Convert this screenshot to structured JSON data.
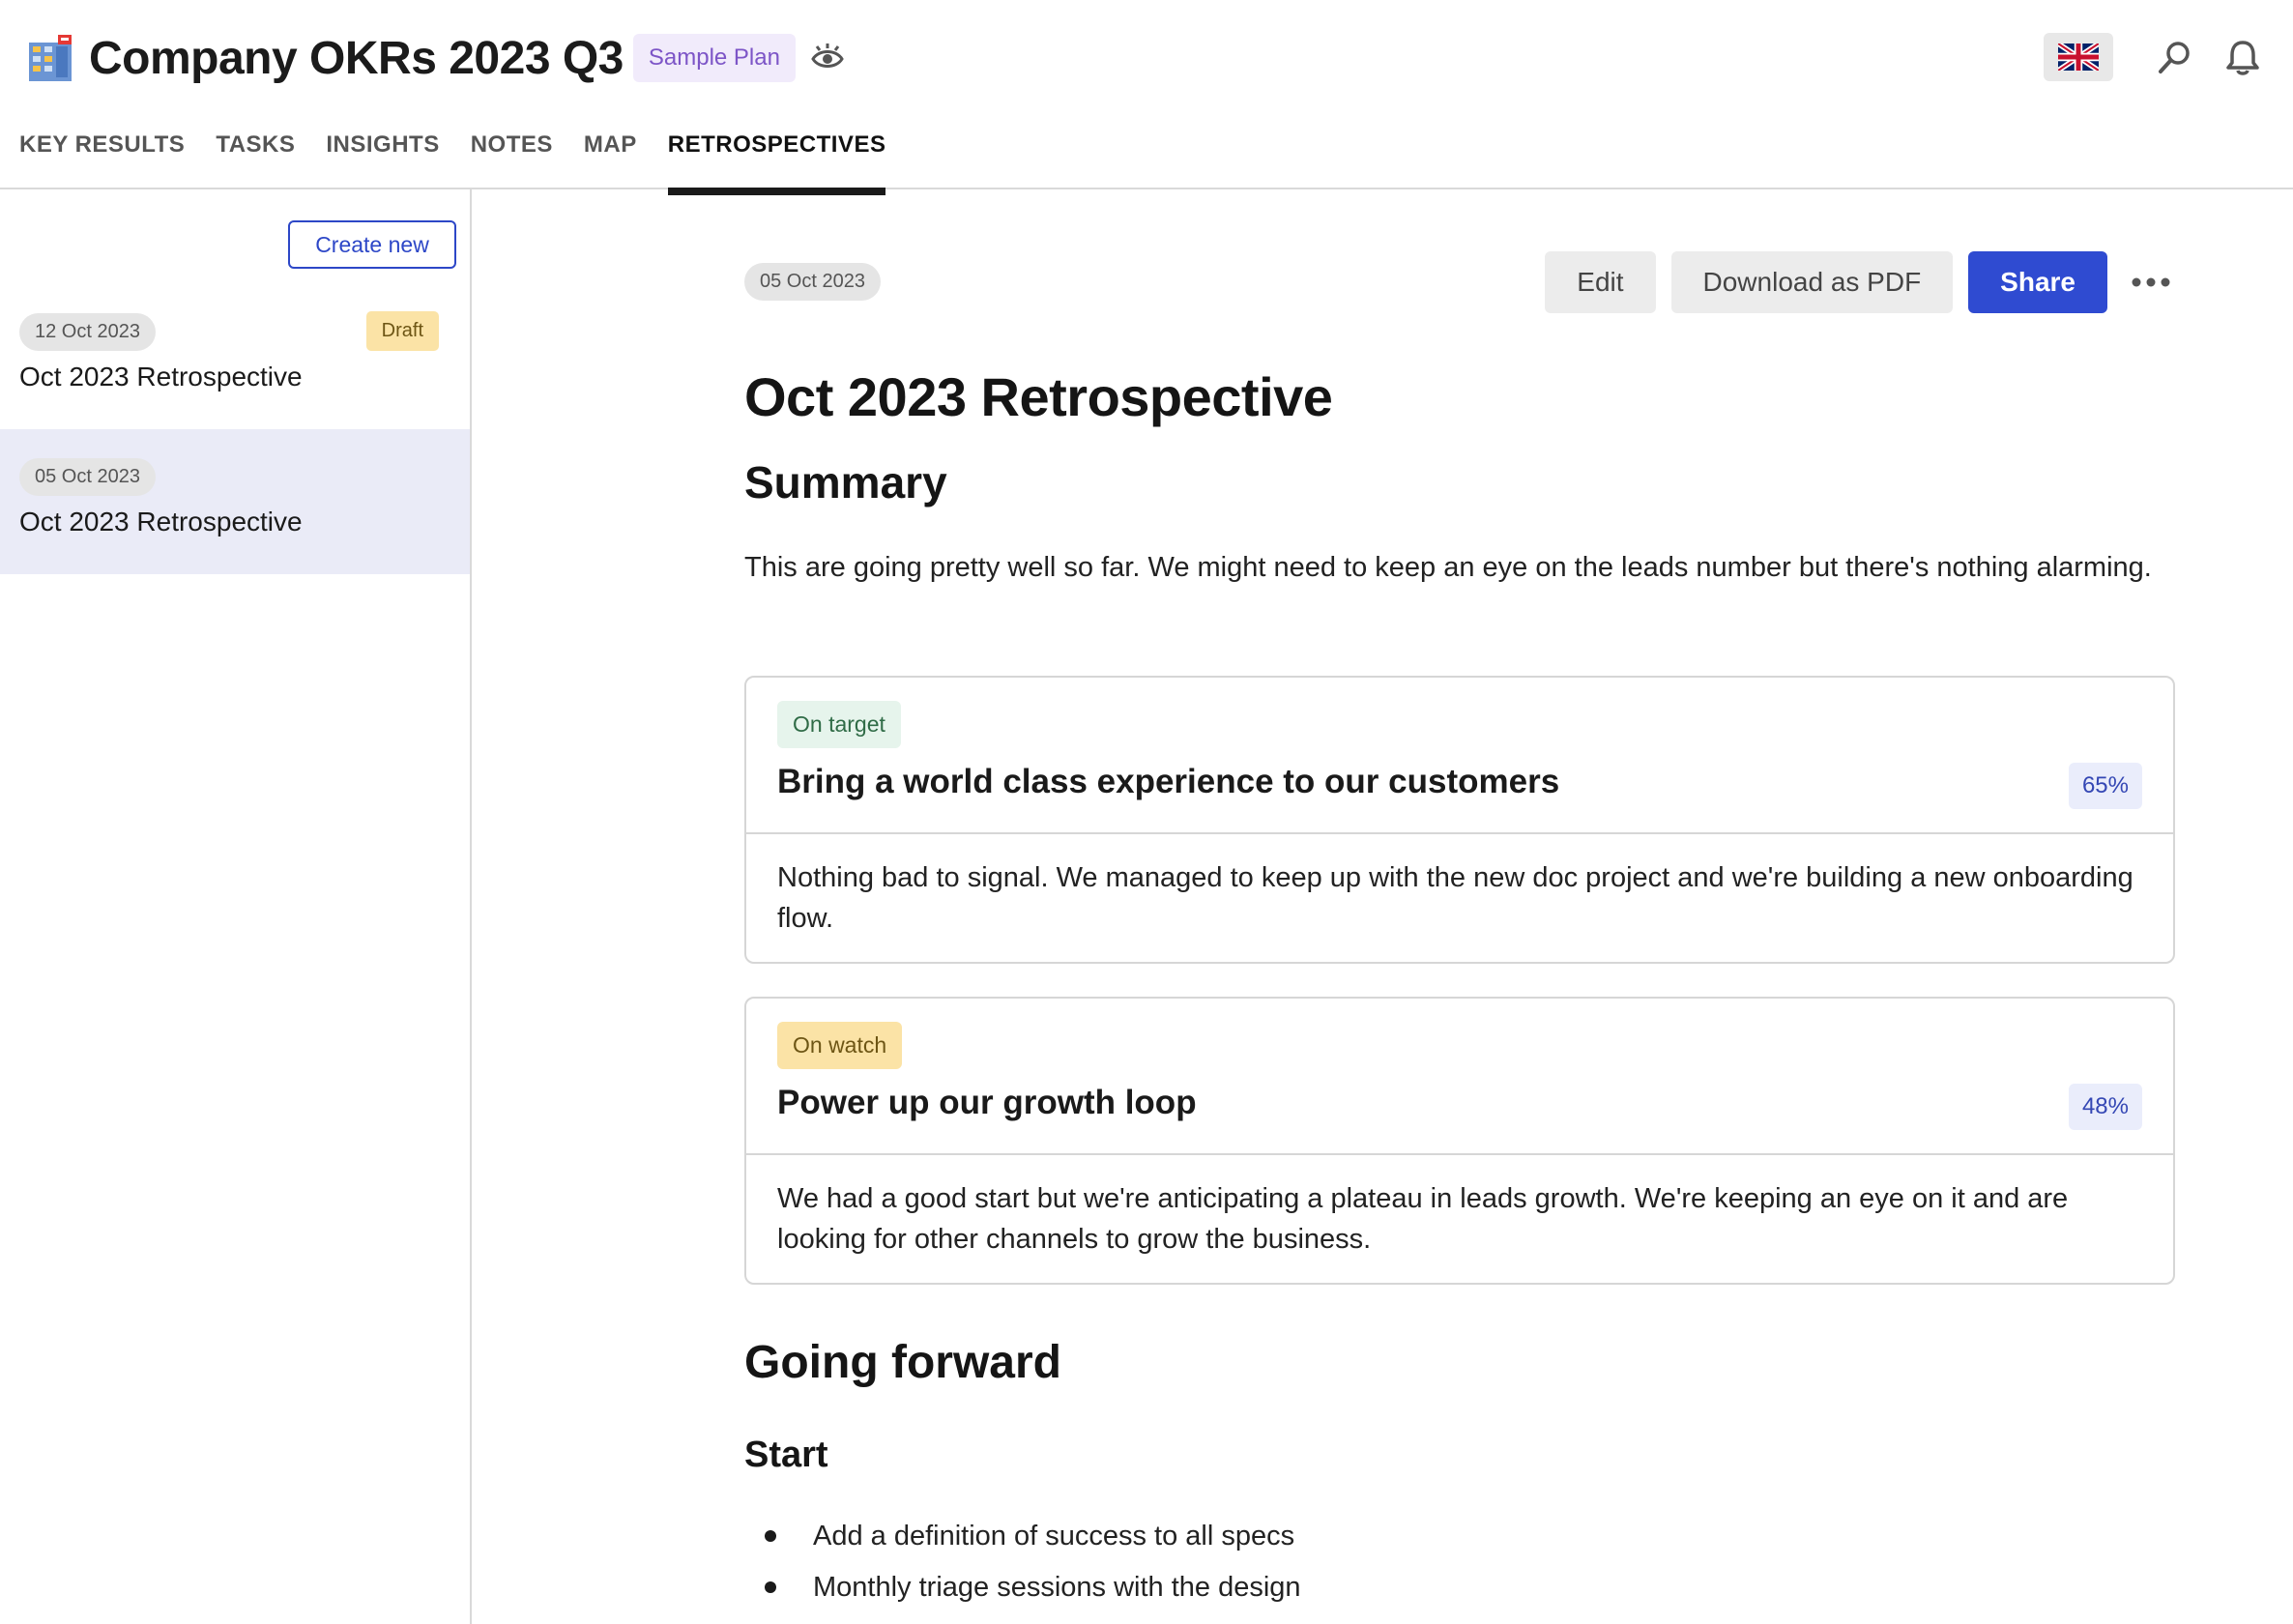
{
  "header": {
    "title": "Company OKRs 2023 Q3",
    "plan_badge": "Sample Plan",
    "app_icon": "building-icon",
    "language_flag": "uk-flag-icon"
  },
  "tabs": [
    {
      "label": "KEY RESULTS",
      "active": false
    },
    {
      "label": "TASKS",
      "active": false
    },
    {
      "label": "INSIGHTS",
      "active": false
    },
    {
      "label": "NOTES",
      "active": false
    },
    {
      "label": "MAP",
      "active": false
    },
    {
      "label": "RETROSPECTIVES",
      "active": true
    }
  ],
  "sidebar": {
    "create_label": "Create new",
    "items": [
      {
        "date": "12 Oct 2023",
        "title": "Oct 2023 Retrospective",
        "badge": "Draft",
        "selected": false
      },
      {
        "date": "05 Oct 2023",
        "title": "Oct 2023 Retrospective",
        "badge": "",
        "selected": true
      }
    ]
  },
  "main": {
    "date": "05 Oct 2023",
    "actions": {
      "edit": "Edit",
      "download": "Download as PDF",
      "share": "Share"
    },
    "title": "Oct 2023 Retrospective",
    "summary_heading": "Summary",
    "summary_text": "This are going pretty well so far. We might need to keep an eye on the leads number but there's nothing alarming.",
    "objectives": [
      {
        "status": "On target",
        "title": "Bring a world class experience to our customers",
        "progress": "65%",
        "note": "Nothing bad to signal. We managed to keep up with the new doc project and we're building a new onboarding flow."
      },
      {
        "status": "On watch",
        "title": "Power up our growth loop",
        "progress": "48%",
        "note": "We had a good start but we're anticipating a plateau in leads growth. We're keeping an eye on it and are looking for other channels to grow the business."
      }
    ],
    "forward_heading": "Going forward",
    "start_heading": "Start",
    "start_items": [
      "Add a definition of success to all specs",
      "Monthly triage sessions with the design"
    ]
  },
  "colors": {
    "accent": "#2f4bd1",
    "on_target_bg": "#e6f4ec",
    "on_watch_bg": "#fbe3a6",
    "selected_bg": "#eaebf7"
  }
}
